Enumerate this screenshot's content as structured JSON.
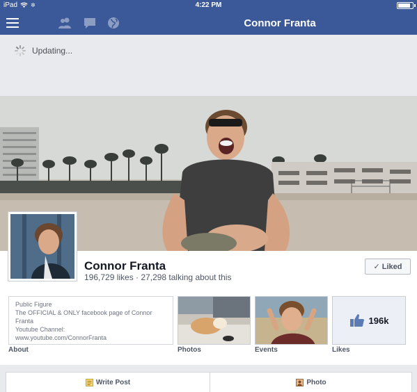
{
  "status_bar": {
    "device": "iPad",
    "time": "4:22 PM",
    "battery_level": 0.85
  },
  "nav": {
    "title": "Connor Franta",
    "icons": [
      "menu-icon",
      "friends-icon",
      "messages-icon",
      "globe-icon"
    ]
  },
  "updating": {
    "text": "Updating..."
  },
  "page": {
    "name": "Connor Franta",
    "stats": "196,729 likes · 27,298 talking about this",
    "liked_label": "Liked"
  },
  "about": {
    "line1": "Public Figure",
    "line2": "The OFFICIAL & ONLY facebook page of Connor",
    "line3": "Franta",
    "line4": "Youtube Channel:",
    "line5": "www.youtube.com/ConnorFranta"
  },
  "tiles": {
    "about_label": "About",
    "photos_label": "Photos",
    "events_label": "Events",
    "likes_label": "Likes",
    "likes_count": "196k"
  },
  "composer": {
    "write_post": "Write Post",
    "photo": "Photo"
  },
  "colors": {
    "brand": "#3b5998",
    "background": "#e9eaed",
    "text_dark": "#141823",
    "text_muted": "#4e5665"
  }
}
